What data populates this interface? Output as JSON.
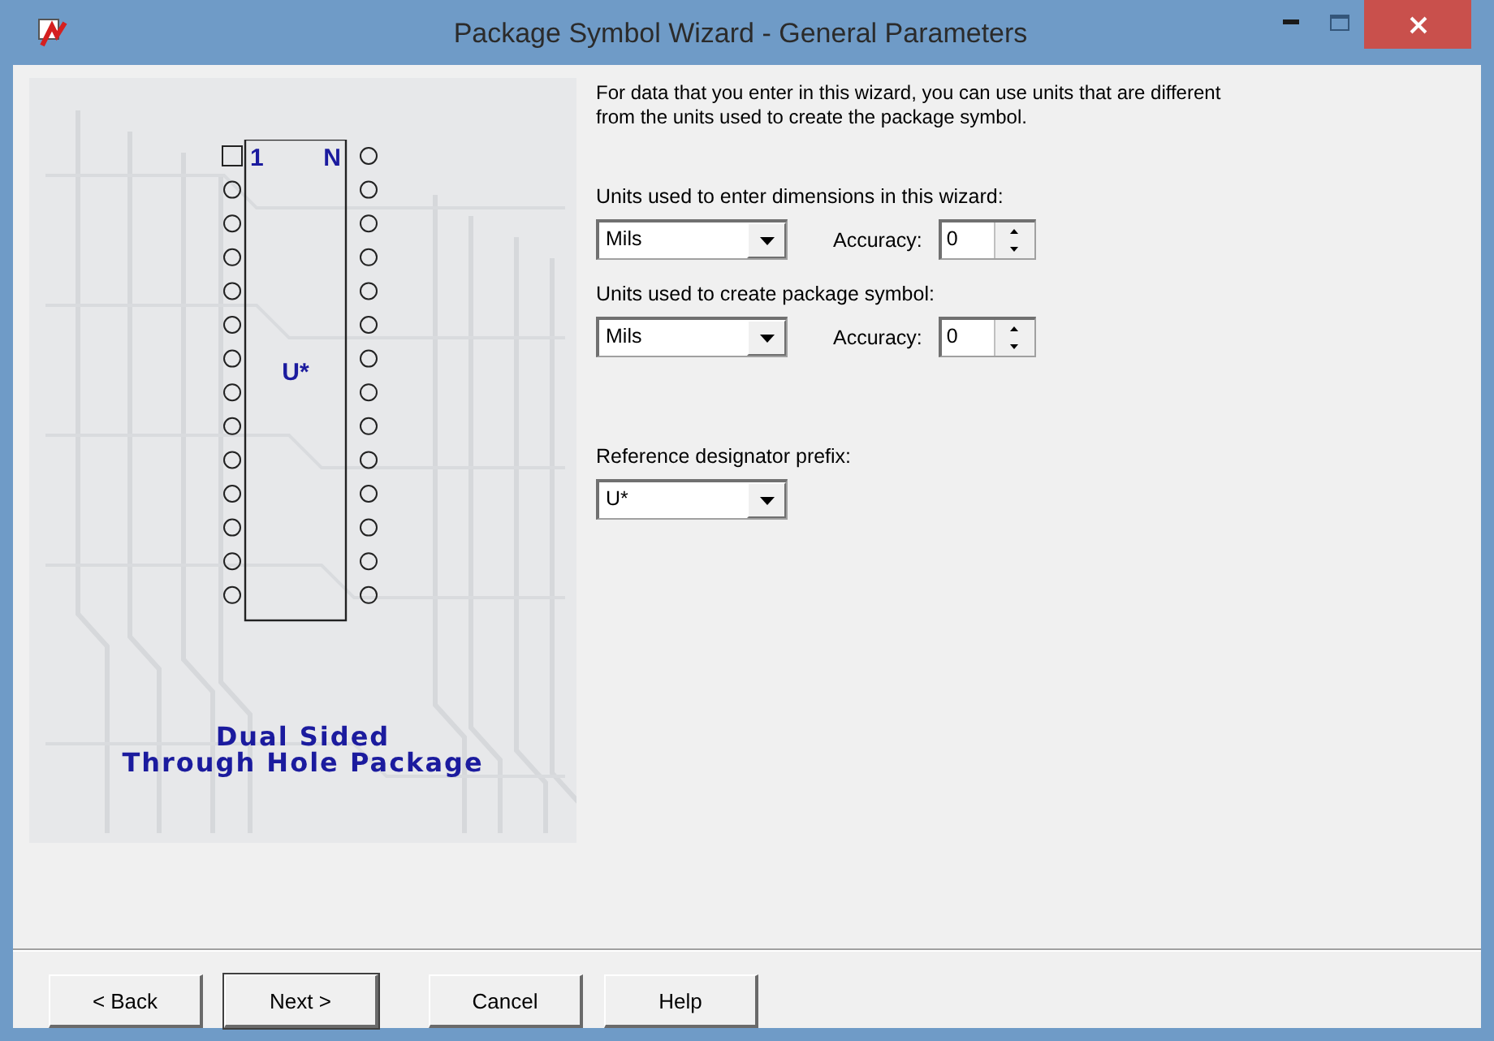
{
  "window": {
    "title": "Package Symbol Wizard - General Parameters"
  },
  "preview": {
    "pin_first": "1",
    "pin_last": "N",
    "designator": "U*",
    "caption": [
      "Dual Sided",
      "Through Hole Package"
    ]
  },
  "intro": "For data that you enter in this wizard, you can use units that are different from the units used to create the package symbol.",
  "unit_groups": [
    {
      "label": "Units used to enter dimensions in this wizard:",
      "unit": "Mils",
      "accuracy_label": "Accuracy:",
      "accuracy": "0"
    },
    {
      "label": "Units used to create package symbol:",
      "unit": "Mils",
      "accuracy_label": "Accuracy:",
      "accuracy": "0"
    }
  ],
  "prefix": {
    "label": "Reference designator prefix:",
    "value": "U*"
  },
  "buttons": [
    {
      "label": "< Back",
      "default": false
    },
    {
      "label": "Next >",
      "default": true
    },
    {
      "label": "Cancel",
      "default": false
    },
    {
      "label": "Help",
      "default": false
    }
  ]
}
